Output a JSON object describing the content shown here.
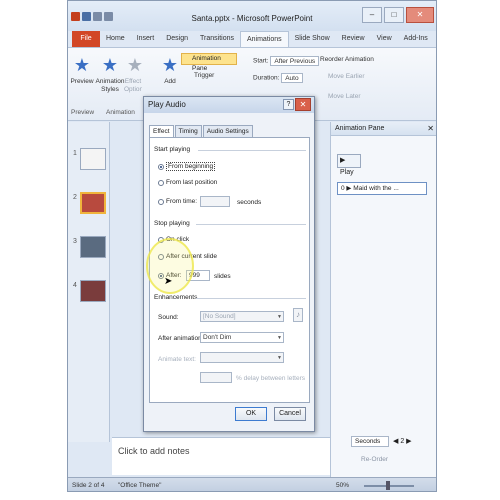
{
  "window": {
    "title": "Santa.pptx - Microsoft PowerPoint",
    "controls": {
      "minimize": "–",
      "maximize": "□",
      "close": "✕"
    }
  },
  "tabs": [
    {
      "label": "File"
    },
    {
      "label": "Home"
    },
    {
      "label": "Insert"
    },
    {
      "label": "Design"
    },
    {
      "label": "Transitions"
    },
    {
      "label": "Animations"
    },
    {
      "label": "Slide Show"
    },
    {
      "label": "Review"
    },
    {
      "label": "View"
    },
    {
      "label": "Add-Ins"
    }
  ],
  "ribbon": {
    "preview_label": "Preview",
    "animation_styles_label": "Animation Styles",
    "effect_options_label": "Effect Options",
    "add_label": "Add",
    "animation_pane_label": "Animation Pane",
    "trigger_label": "Trigger",
    "start_label": "Start:",
    "start_value": "After Previous",
    "duration_label": "Duration:",
    "duration_value": "Auto",
    "reorder_label": "Reorder Animation",
    "move_earlier_label": "Move Earlier",
    "move_later_label": "Move Later",
    "group_preview": "Preview",
    "group_animation": "Animation"
  },
  "thumbnails": [
    {
      "num": "1",
      "color": "#f4f4f4"
    },
    {
      "num": "2",
      "color": "#b84a3e"
    },
    {
      "num": "3",
      "color": "#5a6b80"
    },
    {
      "num": "4",
      "color": "#7a3c3c"
    }
  ],
  "notes_placeholder": "Click to add notes",
  "animation_pane": {
    "title": "Animation Pane",
    "close": "✕",
    "play_label": "Play",
    "item_label": "Maid with the ...",
    "seconds_label": "Seconds",
    "page_value": "2",
    "reorder_label": "Re-Order"
  },
  "status": {
    "slide_info": "Slide 2 of 4",
    "theme": "\"Office Theme\"",
    "zoom": "50%"
  },
  "dialog": {
    "title": "Play Audio",
    "help": "?",
    "close": "✕",
    "tabs": [
      {
        "label": "Effect"
      },
      {
        "label": "Timing"
      },
      {
        "label": "Audio Settings"
      }
    ],
    "start_playing_label": "Start playing",
    "from_beginning": "From beginning",
    "from_last_position": "From last position",
    "from_time": "From time:",
    "seconds_unit": "seconds",
    "stop_playing_label": "Stop playing",
    "on_click": "On click",
    "after_current_slide": "After current slide",
    "after_label": "After:",
    "after_value": "999",
    "slides_unit": "slides",
    "enhancements_label": "Enhancements",
    "sound_label": "Sound:",
    "sound_value": "[No Sound]",
    "after_animation_label": "After animation:",
    "after_animation_value": "Don't Dim",
    "animate_text_label": "Animate text:",
    "delay_label": "% delay between letters",
    "ok_label": "OK",
    "cancel_label": "Cancel"
  }
}
